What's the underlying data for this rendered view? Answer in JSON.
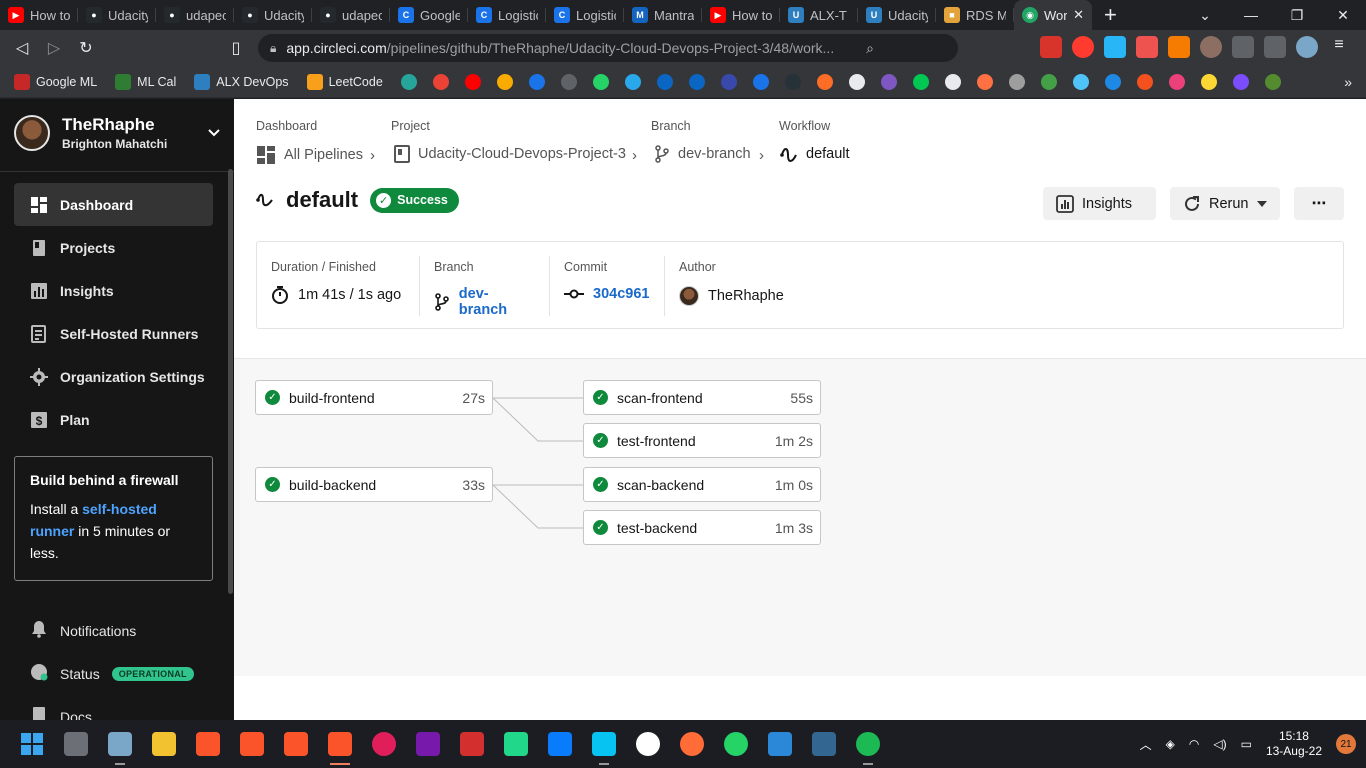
{
  "browser": {
    "tabs": [
      {
        "label": "How to",
        "color": "#ff0000"
      },
      {
        "label": "Udacity",
        "color": "#24292e"
      },
      {
        "label": "udapeo",
        "color": "#24292e"
      },
      {
        "label": "Udacity",
        "color": "#24292e"
      },
      {
        "label": "udapeo",
        "color": "#24292e"
      },
      {
        "label": "Google",
        "color": "#1a73e8"
      },
      {
        "label": "Logistic",
        "color": "#1a73e8"
      },
      {
        "label": "Logistic",
        "color": "#1a73e8"
      },
      {
        "label": "Mantra",
        "color": "#1565c0"
      },
      {
        "label": "How to",
        "color": "#ff0000"
      },
      {
        "label": "ALX-T C",
        "color": "#2e7fbf"
      },
      {
        "label": "Udacity",
        "color": "#2e7fbf"
      },
      {
        "label": "RDS Ma",
        "color": "#e2a33a"
      },
      {
        "label": "Wor",
        "color": "#22a565"
      }
    ],
    "url_host": "app.circleci.com",
    "url_path": "/pipelines/github/TheRhaphe/Udacity-Cloud-Devops-Project-3/48/work...",
    "bookmarks": [
      "Google ML",
      "ML Cal",
      "ALX DevOps",
      "LeetCode"
    ]
  },
  "sidebar": {
    "username": "TheRhaphe",
    "fullname": "Brighton Mahatchi",
    "nav": [
      "Dashboard",
      "Projects",
      "Insights",
      "Self-Hosted Runners",
      "Organization Settings",
      "Plan"
    ],
    "promo": {
      "title": "Build behind a firewall",
      "text_before": "Install a ",
      "link": "self-hosted runner",
      "text_after": " in 5 minutes or less."
    },
    "bottom": {
      "notifications": "Notifications",
      "status": "Status",
      "status_badge": "OPERATIONAL",
      "docs": "Docs"
    }
  },
  "breadcrumb": {
    "labels": [
      "Dashboard",
      "Project",
      "Branch",
      "Workflow"
    ],
    "values": [
      "All Pipelines",
      "Udacity-Cloud-Devops-Project-3",
      "dev-branch",
      "default"
    ]
  },
  "workflow": {
    "name": "default",
    "status": "Success",
    "insights_label": "Insights",
    "rerun_label": "Rerun",
    "more_label": "⋯"
  },
  "summary": {
    "duration_label": "Duration / Finished",
    "duration_value": "1m 41s / 1s ago",
    "branch_label": "Branch",
    "branch_value": "dev-branch",
    "commit_label": "Commit",
    "commit_value": "304c961",
    "author_label": "Author",
    "author_value": "TheRhaphe"
  },
  "jobs": [
    {
      "name": "build-frontend",
      "duration": "27s"
    },
    {
      "name": "scan-frontend",
      "duration": "55s"
    },
    {
      "name": "test-frontend",
      "duration": "1m 2s"
    },
    {
      "name": "build-backend",
      "duration": "33s"
    },
    {
      "name": "scan-backend",
      "duration": "1m 0s"
    },
    {
      "name": "test-backend",
      "duration": "1m 3s"
    }
  ],
  "taskbar": {
    "time": "15:18",
    "date": "13-Aug-22",
    "notifications": "21"
  },
  "colors": {
    "success": "#0f8a3c",
    "link": "#1b6ac9",
    "sidebar": "#161616"
  }
}
